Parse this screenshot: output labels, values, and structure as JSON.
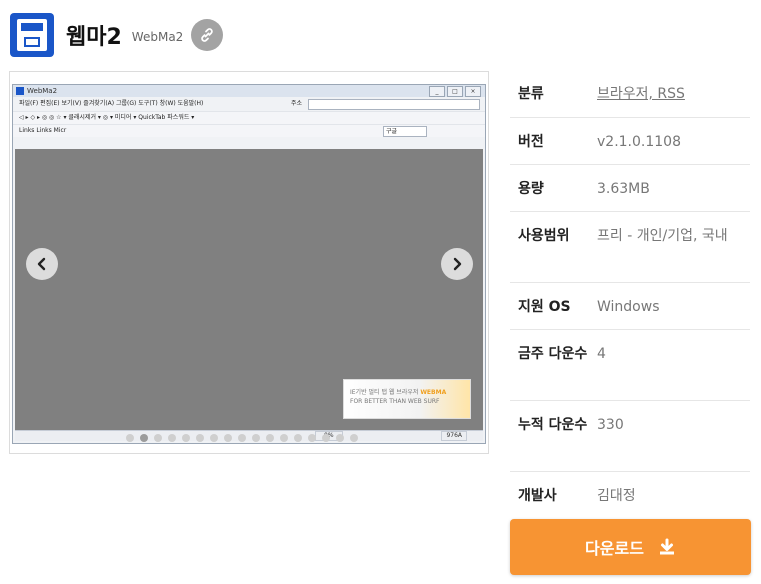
{
  "header": {
    "title": "웹마2",
    "subtitle": "WebMa2",
    "link_icon": "link-icon"
  },
  "screenshot": {
    "window_title": "WebMa2",
    "menu": "파일(F)  편집(E)  보기(V)  즐겨찾기(A)  그룹(G)  도구(T)  창(W)  도움말(H)",
    "address_label": "주소",
    "toolbar1": "◁ ▸ ◇ ▸ ◎ ◎ ☆ ▾  클래시제거 ▾  ◎ ▾   미디어 ▾   QuickTab   파스워드 ▾",
    "toolbar2": "Links   Links   Micr",
    "search_value": "구글",
    "banner_text": "IE기반 멀티 탭 웹 브라우저",
    "banner_brand": "WEBMA",
    "banner_sub": "FOR BETTER THAN WEB SURF",
    "status_percent": "0%",
    "status_size": "976A"
  },
  "gallery": {
    "prev_icon": "chevron-left-icon",
    "next_icon": "chevron-right-icon",
    "slide_count": 17,
    "active_slide": 1
  },
  "info": {
    "category_label": "분류",
    "category_value": "브라우저, RSS",
    "version_label": "버전",
    "version_value": "v2.1.0.1108",
    "size_label": "용량",
    "size_value": "3.63MB",
    "license_label": "사용범위",
    "license_value": "프리 - 개인/기업, 국내",
    "os_label": "지원 OS",
    "os_value": "Windows",
    "weekly_label": "금주 다운수",
    "weekly_value": "4",
    "total_label": "누적 다운수",
    "total_value": "330",
    "developer_label": "개발사",
    "developer_value": "김대정"
  },
  "download": {
    "label": "다운로드",
    "icon": "download-icon"
  },
  "colors": {
    "accent": "#f79433",
    "logo": "#1a56c8"
  }
}
